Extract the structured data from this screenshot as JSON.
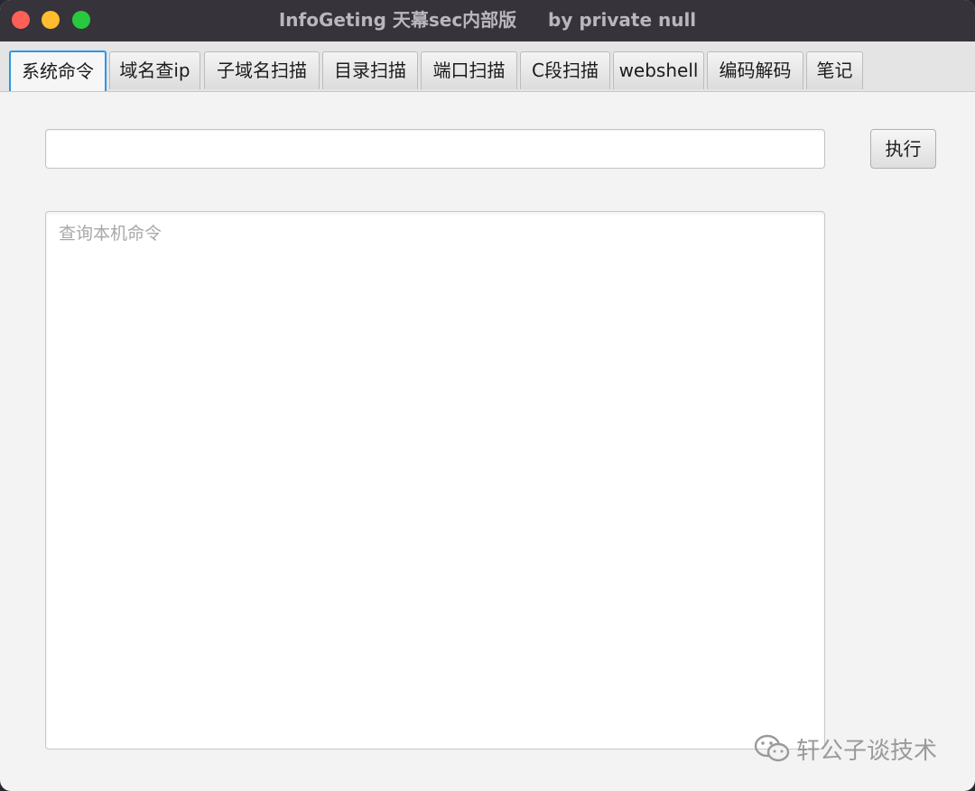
{
  "window": {
    "title": "InfoGeting 天幕sec内部版     by private null"
  },
  "tabs": [
    {
      "label": "系统命令",
      "active": true
    },
    {
      "label": "域名查ip",
      "active": false
    },
    {
      "label": "子域名扫描",
      "active": false
    },
    {
      "label": "目录扫描",
      "active": false
    },
    {
      "label": "端口扫描",
      "active": false
    },
    {
      "label": "C段扫描",
      "active": false
    },
    {
      "label": "webshell",
      "active": false
    },
    {
      "label": "编码解码",
      "active": false
    },
    {
      "label": "笔记",
      "active": false
    }
  ],
  "command": {
    "input_value": "",
    "execute_label": "执行"
  },
  "output": {
    "placeholder": "查询本机命令"
  },
  "watermark": {
    "text": "轩公子谈技术",
    "icon": "wechat-icon"
  },
  "colors": {
    "titlebar": "#36333a",
    "active_tab_border": "#2b98e6",
    "close": "#fe5f57",
    "minimize": "#febc2e",
    "maximize": "#28c840"
  }
}
